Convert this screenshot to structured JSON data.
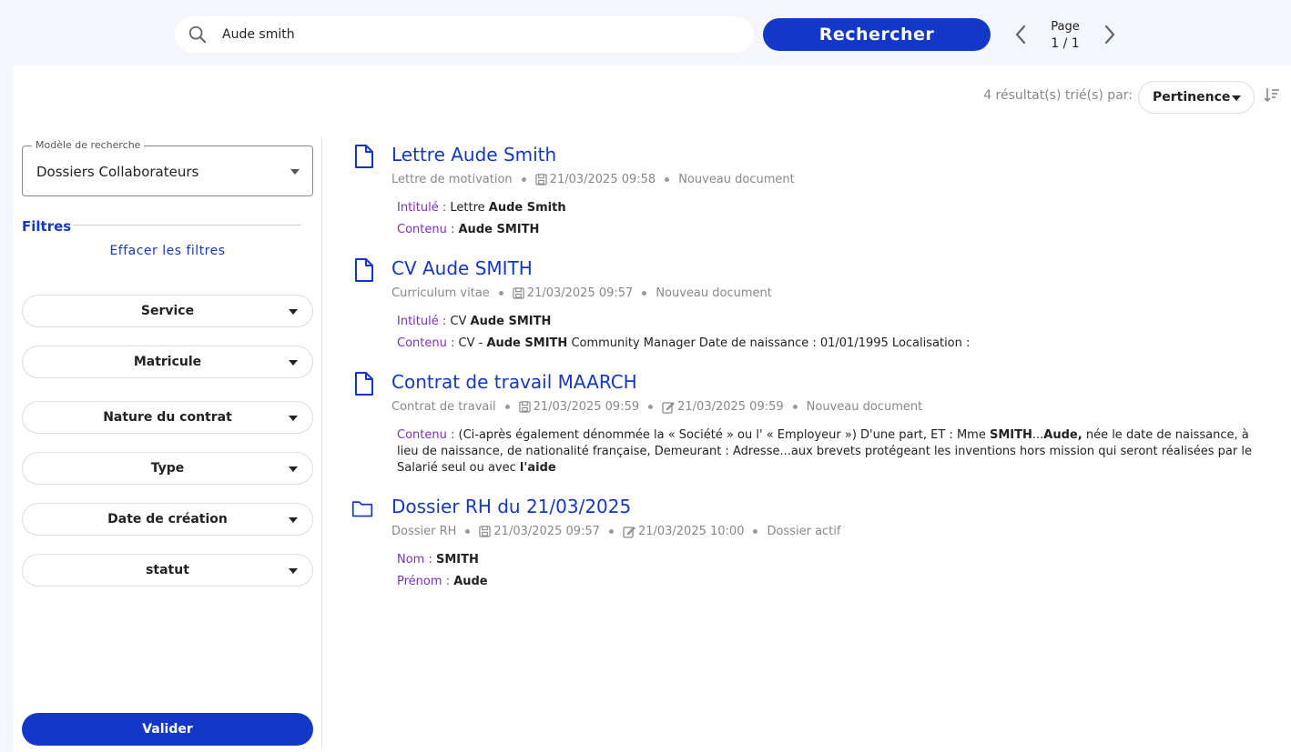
{
  "search": {
    "value": "Aude smith",
    "button_label": "Rechercher"
  },
  "pager": {
    "label": "Page",
    "current": "1",
    "separator": "/",
    "total": "1",
    "display": "1 / 1"
  },
  "results_header": {
    "count_text": "4 résultat(s) trié(s) par:",
    "sort_value": "Pertinence"
  },
  "sidebar": {
    "model_label": "Modèle de recherche",
    "model_value": "Dossiers Collaborateurs",
    "filters_title": "Filtres",
    "clear_filters": "Effacer les filtres",
    "filters": [
      {
        "label": "Service"
      },
      {
        "label": "Matricule"
      },
      {
        "label": "Nature du contrat"
      },
      {
        "label": "Type"
      },
      {
        "label": "Date de création"
      },
      {
        "label": "statut"
      }
    ],
    "validate_label": "Valider"
  },
  "results": [
    {
      "icon": "document-icon",
      "title": "Lettre Aude Smith",
      "type": "Lettre de motivation",
      "created": "21/03/2025 09:58",
      "modified": "",
      "status": "Nouveau document",
      "fields": [
        {
          "label": "Intitulé :",
          "text_before": "Lettre",
          "bold": "Aude Smith",
          "text_after": ""
        },
        {
          "label": "Contenu :",
          "text_before": "",
          "bold": "Aude SMITH",
          "text_after": ""
        }
      ]
    },
    {
      "icon": "document-icon",
      "title": "CV Aude SMITH",
      "type": "Curriculum vitae",
      "created": "21/03/2025 09:57",
      "modified": "",
      "status": "Nouveau document",
      "fields": [
        {
          "label": "Intitulé :",
          "text_before": "CV",
          "bold": "Aude SMITH",
          "text_after": ""
        },
        {
          "label": "Contenu :",
          "text_before": "CV -",
          "bold": "Aude SMITH",
          "text_after": "Community Manager Date de naissance : 01/01/1995 Localisation :"
        }
      ]
    },
    {
      "icon": "document-icon",
      "title": "Contrat de travail MAARCH",
      "type": "Contrat de travail",
      "created": "21/03/2025 09:59",
      "modified": "21/03/2025 09:59",
      "status": "Nouveau document",
      "content": {
        "label": "Contenu :",
        "part1": "(Ci-après également dénommée la « Société » ou l' « Employeur ») D'une part, ET : Mme",
        "bold1": "SMITH",
        "part2": "...",
        "bold2": "Aude,",
        "part3": "née le date de naissance, à lieu de naissance, de nationalité française, Demeurant : Adresse...aux brevets protégeant les inventions hors mission qui seront réalisées par le Salarié seul ou avec",
        "bold3": "l'aide"
      }
    },
    {
      "icon": "folder-icon",
      "title": "Dossier RH du 21/03/2025",
      "type": "Dossier RH",
      "created": "21/03/2025 09:57",
      "modified": "21/03/2025 10:00",
      "status": "Dossier actif",
      "fields": [
        {
          "label": "Nom :",
          "text_before": "",
          "bold": "SMITH",
          "text_after": ""
        },
        {
          "label": "Prénom :",
          "text_before": "",
          "bold": "Aude",
          "text_after": ""
        }
      ]
    }
  ],
  "colors": {
    "accent": "#1338c7",
    "label": "#7b2fbf",
    "muted": "#888888"
  }
}
